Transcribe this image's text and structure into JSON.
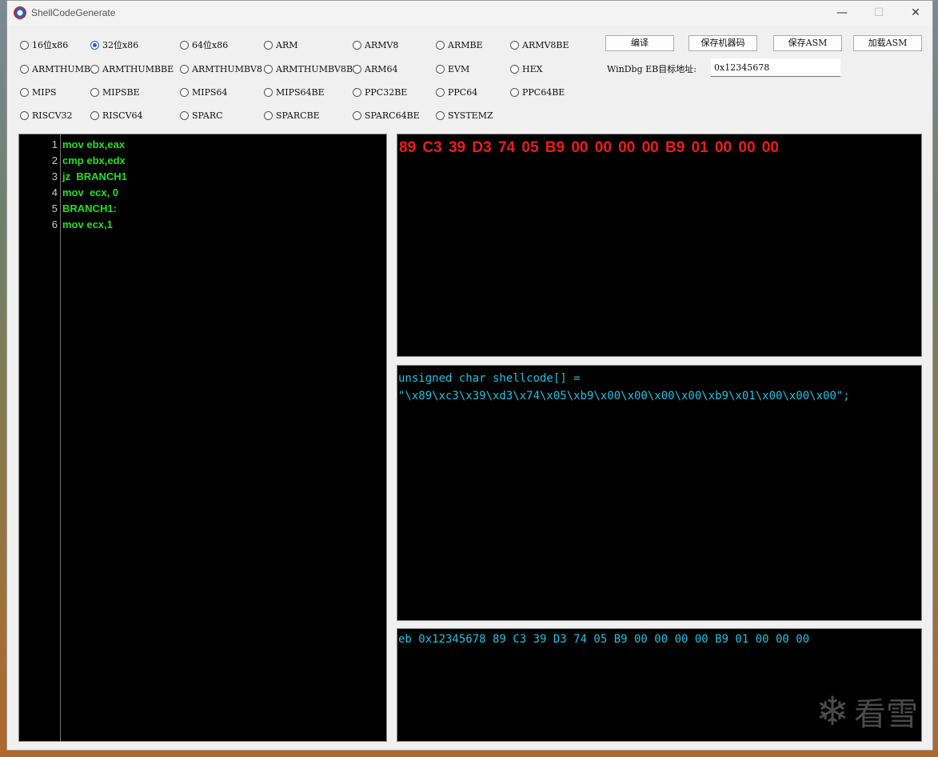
{
  "window": {
    "title": "ShellCodeGenerate",
    "minimize": "—",
    "maximize": "☐",
    "close": "✕"
  },
  "arch_options": [
    "16位x86",
    "32位x86",
    "64位x86",
    "ARM",
    "ARMV8",
    "ARMBE",
    "ARMV8BE",
    "ARMTHUMB",
    "ARMTHUMBBE",
    "ARMTHUMBV8",
    "ARMTHUMBV8BE",
    "ARM64",
    "EVM",
    "HEX",
    "MIPS",
    "MIPSBE",
    "MIPS64",
    "MIPS64BE",
    "PPC32BE",
    "PPC64",
    "PPC64BE",
    "RISCV32",
    "RISCV64",
    "SPARC",
    "SPARCBE",
    "SPARC64BE",
    "SYSTEMZ"
  ],
  "selected_arch": "32位x86",
  "toolbar": {
    "compile": "编译",
    "save_machine_code": "保存机器码",
    "save_asm": "保存ASM",
    "load_asm": "加载ASM"
  },
  "windbg": {
    "label": "WinDbg EB目标地址:",
    "value": "0x12345678"
  },
  "editor": {
    "line_numbers": [
      "1",
      "2",
      "3",
      "4",
      "5",
      "6"
    ],
    "lines": [
      "mov ebx,eax",
      "cmp ebx,edx",
      "jz  BRANCH1",
      "mov  ecx, 0",
      "BRANCH1:",
      "mov ecx,1"
    ]
  },
  "output": {
    "hex": "89 C3 39 D3 74 05 B9 00 00 00 00 B9 01 00 00 00",
    "c_array_line1": "unsigned char shellcode[] =",
    "c_array_line2": "\"\\x89\\xc3\\x39\\xd3\\x74\\x05\\xb9\\x00\\x00\\x00\\x00\\xb9\\x01\\x00\\x00\\x00\";",
    "windbg_cmd": "eb 0x12345678 89 C3 39 D3 74 05 B9 00 00 00 00 B9 01 00 00 00"
  },
  "watermark": {
    "icon": "snowflake-icon",
    "text": "看雪"
  }
}
